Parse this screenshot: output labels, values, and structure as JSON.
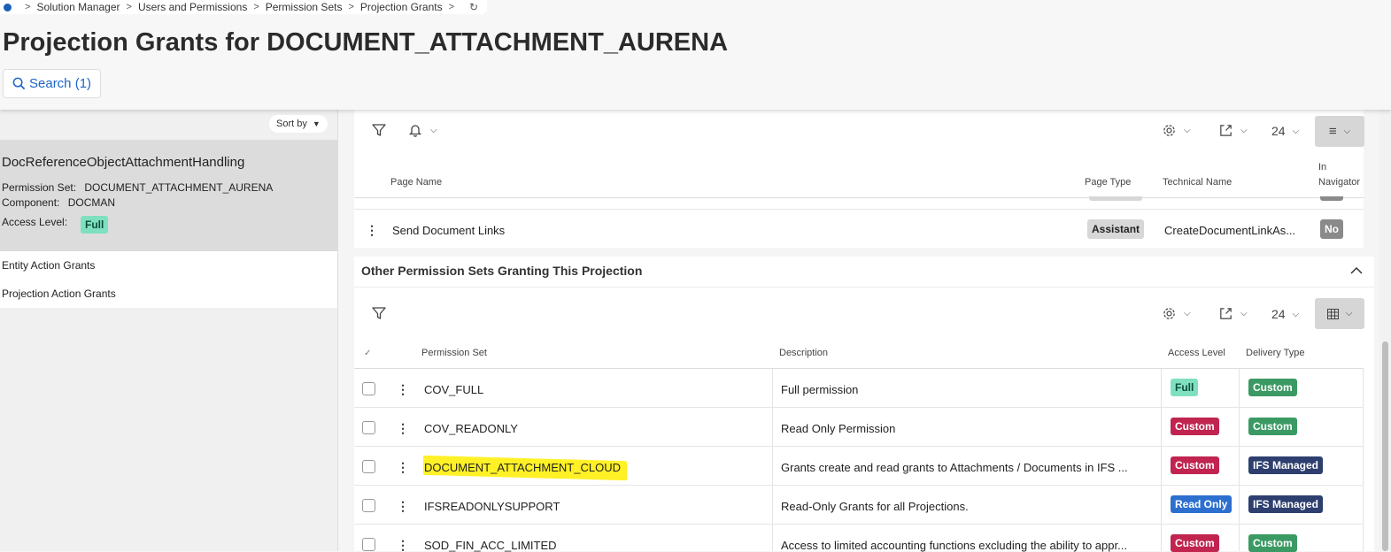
{
  "breadcrumb": [
    "Solution Manager",
    "Users and Permissions",
    "Permission Sets",
    "Projection Grants"
  ],
  "header": {
    "title": "Projection Grants for DOCUMENT_ATTACHMENT_AURENA",
    "search_label": "Search (1)"
  },
  "sidebar": {
    "sort_label": "Sort by",
    "card": {
      "title": "DocReferenceObjectAttachmentHandling",
      "permission_set_label": "Permission Set:",
      "permission_set_value": "DOCUMENT_ATTACHMENT_AURENA",
      "component_label": "Component:",
      "component_value": "DOCMAN",
      "access_level_label": "Access Level:",
      "access_level_value": "Full"
    },
    "links": [
      "Entity Action Grants",
      "Projection Action Grants"
    ]
  },
  "pages_table": {
    "page_size": "24",
    "columns": {
      "page_name": "Page Name",
      "page_type": "Page Type",
      "technical_name": "Technical Name",
      "in_navigator": [
        "In",
        "Navigator"
      ]
    },
    "rows": [
      {
        "page_name": "Send Document Links",
        "page_type": "Assistant",
        "technical_name": "CreateDocumentLinkAs...",
        "in_navigator": "No"
      }
    ]
  },
  "other_sets": {
    "title": "Other Permission Sets Granting This Projection",
    "page_size": "24",
    "columns": {
      "permission_set": "Permission Set",
      "description": "Description",
      "access_level": "Access Level",
      "delivery_type": "Delivery Type"
    },
    "rows": [
      {
        "permission_set": "COV_FULL",
        "description": "Full permission",
        "access_level": "Full",
        "delivery_type": "Custom"
      },
      {
        "permission_set": "COV_READONLY",
        "description": "Read Only Permission",
        "access_level": "Custom",
        "delivery_type": "Custom"
      },
      {
        "permission_set": "DOCUMENT_ATTACHMENT_CLOUD",
        "description": "Grants create and read grants to Attachments / Documents in IFS ...",
        "access_level": "Custom",
        "delivery_type": "IFS Managed"
      },
      {
        "permission_set": "IFSREADONLYSUPPORT",
        "description": "Read-Only Grants for all Projections.",
        "access_level": "Read Only",
        "delivery_type": "IFS Managed"
      },
      {
        "permission_set": "SOD_FIN_ACC_LIMITED",
        "description": "Access to limited accounting functions excluding the ability to appr...",
        "access_level": "Custom",
        "delivery_type": "Custom"
      }
    ]
  },
  "colors": {
    "accent": "#1c64c8",
    "full": "#7fe0c0",
    "custom_access": "#c0244f",
    "custom_delivery": "#3b9a63",
    "ifs_managed": "#2e3f6f",
    "read_only": "#2d6fcf",
    "highlight": "#ffee00"
  }
}
